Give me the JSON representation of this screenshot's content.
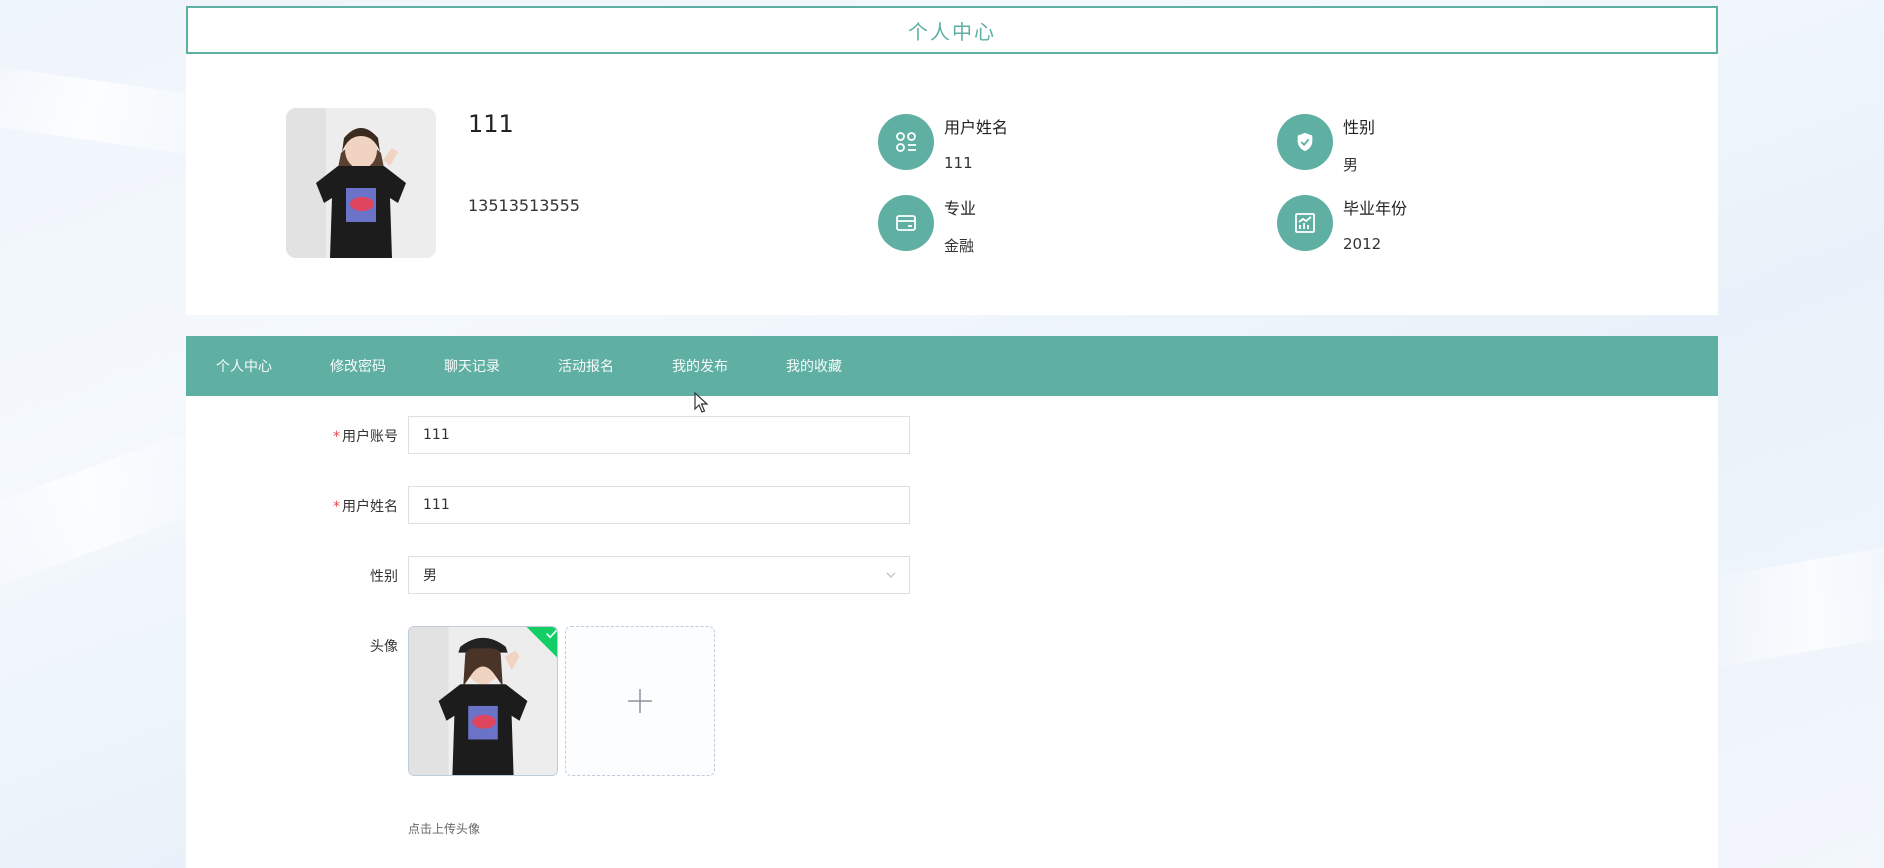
{
  "header": {
    "title": "个人中心"
  },
  "profile": {
    "display_name": "111",
    "phone": "13513513555",
    "info": {
      "username": {
        "label": "用户姓名",
        "value": "111",
        "icon": "apps-icon"
      },
      "gender": {
        "label": "性别",
        "value": "男",
        "icon": "shield-check-icon"
      },
      "major": {
        "label": "专业",
        "value": "金融",
        "icon": "wallet-card-icon"
      },
      "grad_year": {
        "label": "毕业年份",
        "value": "2012",
        "icon": "chart-icon"
      }
    }
  },
  "tabs": [
    {
      "label": "个人中心",
      "active": true
    },
    {
      "label": "修改密码",
      "active": false
    },
    {
      "label": "聊天记录",
      "active": false
    },
    {
      "label": "活动报名",
      "active": false
    },
    {
      "label": "我的发布",
      "active": false
    },
    {
      "label": "我的收藏",
      "active": false
    }
  ],
  "form": {
    "account": {
      "required_mark": "*",
      "label": "用户账号",
      "value": "111"
    },
    "name": {
      "required_mark": "*",
      "label": "用户姓名",
      "value": "111"
    },
    "gender": {
      "label": "性别",
      "value": "男"
    },
    "avatar": {
      "label": "头像",
      "tip": "点击上传头像"
    }
  },
  "colors": {
    "accent": "#5fb0a3",
    "required": "#e14c4c",
    "success": "#13ce66"
  }
}
